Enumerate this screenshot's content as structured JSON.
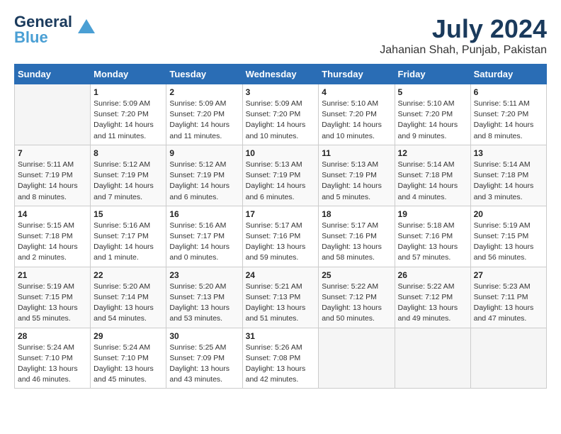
{
  "header": {
    "logo_line1": "General",
    "logo_line2": "Blue",
    "month": "July 2024",
    "location": "Jahanian Shah, Punjab, Pakistan"
  },
  "weekdays": [
    "Sunday",
    "Monday",
    "Tuesday",
    "Wednesday",
    "Thursday",
    "Friday",
    "Saturday"
  ],
  "weeks": [
    [
      {
        "day": "",
        "info": ""
      },
      {
        "day": "1",
        "info": "Sunrise: 5:09 AM\nSunset: 7:20 PM\nDaylight: 14 hours\nand 11 minutes."
      },
      {
        "day": "2",
        "info": "Sunrise: 5:09 AM\nSunset: 7:20 PM\nDaylight: 14 hours\nand 11 minutes."
      },
      {
        "day": "3",
        "info": "Sunrise: 5:09 AM\nSunset: 7:20 PM\nDaylight: 14 hours\nand 10 minutes."
      },
      {
        "day": "4",
        "info": "Sunrise: 5:10 AM\nSunset: 7:20 PM\nDaylight: 14 hours\nand 10 minutes."
      },
      {
        "day": "5",
        "info": "Sunrise: 5:10 AM\nSunset: 7:20 PM\nDaylight: 14 hours\nand 9 minutes."
      },
      {
        "day": "6",
        "info": "Sunrise: 5:11 AM\nSunset: 7:20 PM\nDaylight: 14 hours\nand 8 minutes."
      }
    ],
    [
      {
        "day": "7",
        "info": "Sunrise: 5:11 AM\nSunset: 7:19 PM\nDaylight: 14 hours\nand 8 minutes."
      },
      {
        "day": "8",
        "info": "Sunrise: 5:12 AM\nSunset: 7:19 PM\nDaylight: 14 hours\nand 7 minutes."
      },
      {
        "day": "9",
        "info": "Sunrise: 5:12 AM\nSunset: 7:19 PM\nDaylight: 14 hours\nand 6 minutes."
      },
      {
        "day": "10",
        "info": "Sunrise: 5:13 AM\nSunset: 7:19 PM\nDaylight: 14 hours\nand 6 minutes."
      },
      {
        "day": "11",
        "info": "Sunrise: 5:13 AM\nSunset: 7:19 PM\nDaylight: 14 hours\nand 5 minutes."
      },
      {
        "day": "12",
        "info": "Sunrise: 5:14 AM\nSunset: 7:18 PM\nDaylight: 14 hours\nand 4 minutes."
      },
      {
        "day": "13",
        "info": "Sunrise: 5:14 AM\nSunset: 7:18 PM\nDaylight: 14 hours\nand 3 minutes."
      }
    ],
    [
      {
        "day": "14",
        "info": "Sunrise: 5:15 AM\nSunset: 7:18 PM\nDaylight: 14 hours\nand 2 minutes."
      },
      {
        "day": "15",
        "info": "Sunrise: 5:16 AM\nSunset: 7:17 PM\nDaylight: 14 hours\nand 1 minute."
      },
      {
        "day": "16",
        "info": "Sunrise: 5:16 AM\nSunset: 7:17 PM\nDaylight: 14 hours\nand 0 minutes."
      },
      {
        "day": "17",
        "info": "Sunrise: 5:17 AM\nSunset: 7:16 PM\nDaylight: 13 hours\nand 59 minutes."
      },
      {
        "day": "18",
        "info": "Sunrise: 5:17 AM\nSunset: 7:16 PM\nDaylight: 13 hours\nand 58 minutes."
      },
      {
        "day": "19",
        "info": "Sunrise: 5:18 AM\nSunset: 7:16 PM\nDaylight: 13 hours\nand 57 minutes."
      },
      {
        "day": "20",
        "info": "Sunrise: 5:19 AM\nSunset: 7:15 PM\nDaylight: 13 hours\nand 56 minutes."
      }
    ],
    [
      {
        "day": "21",
        "info": "Sunrise: 5:19 AM\nSunset: 7:15 PM\nDaylight: 13 hours\nand 55 minutes."
      },
      {
        "day": "22",
        "info": "Sunrise: 5:20 AM\nSunset: 7:14 PM\nDaylight: 13 hours\nand 54 minutes."
      },
      {
        "day": "23",
        "info": "Sunrise: 5:20 AM\nSunset: 7:13 PM\nDaylight: 13 hours\nand 53 minutes."
      },
      {
        "day": "24",
        "info": "Sunrise: 5:21 AM\nSunset: 7:13 PM\nDaylight: 13 hours\nand 51 minutes."
      },
      {
        "day": "25",
        "info": "Sunrise: 5:22 AM\nSunset: 7:12 PM\nDaylight: 13 hours\nand 50 minutes."
      },
      {
        "day": "26",
        "info": "Sunrise: 5:22 AM\nSunset: 7:12 PM\nDaylight: 13 hours\nand 49 minutes."
      },
      {
        "day": "27",
        "info": "Sunrise: 5:23 AM\nSunset: 7:11 PM\nDaylight: 13 hours\nand 47 minutes."
      }
    ],
    [
      {
        "day": "28",
        "info": "Sunrise: 5:24 AM\nSunset: 7:10 PM\nDaylight: 13 hours\nand 46 minutes."
      },
      {
        "day": "29",
        "info": "Sunrise: 5:24 AM\nSunset: 7:10 PM\nDaylight: 13 hours\nand 45 minutes."
      },
      {
        "day": "30",
        "info": "Sunrise: 5:25 AM\nSunset: 7:09 PM\nDaylight: 13 hours\nand 43 minutes."
      },
      {
        "day": "31",
        "info": "Sunrise: 5:26 AM\nSunset: 7:08 PM\nDaylight: 13 hours\nand 42 minutes."
      },
      {
        "day": "",
        "info": ""
      },
      {
        "day": "",
        "info": ""
      },
      {
        "day": "",
        "info": ""
      }
    ]
  ]
}
